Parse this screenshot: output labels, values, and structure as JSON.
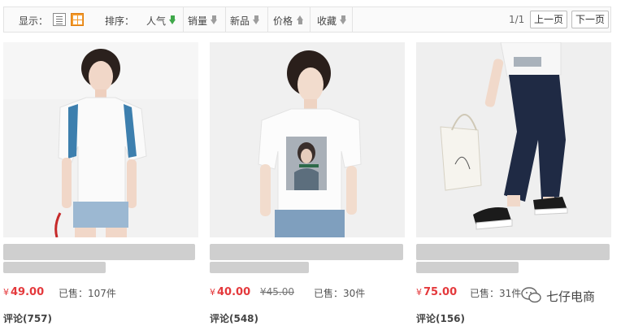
{
  "toolbar": {
    "display_label": "显示：",
    "sort_label": "排序：",
    "sort_items": [
      {
        "label": "人气",
        "arrow": "down",
        "active": true
      },
      {
        "label": "销量",
        "arrow": "down",
        "active": false
      },
      {
        "label": "新品",
        "arrow": "down",
        "active": false
      },
      {
        "label": "价格",
        "arrow": "up",
        "active": false
      },
      {
        "label": "收藏",
        "arrow": "down",
        "active": false
      }
    ],
    "page_count": "1/1",
    "prev_label": "上一页",
    "next_label": "下一页"
  },
  "colors": {
    "active_arrow": "#3fa84a",
    "inactive_arrow": "#9d9d9d",
    "grid_icon": "#f39a2c",
    "price": "#e4393c"
  },
  "products": [
    {
      "currency": "¥",
      "price": "49.00",
      "original_price": "",
      "sold": "已售：107件",
      "comments": "评论(757)"
    },
    {
      "currency": "¥",
      "price": "40.00",
      "original_price": "¥45.00",
      "sold": "已售：30件",
      "comments": "评论(548)"
    },
    {
      "currency": "¥",
      "price": "75.00",
      "original_price": "",
      "sold": "已售：31件",
      "comments": "评论(156)"
    }
  ],
  "watermark": {
    "text": "七仔电商",
    "icon": "wechat-icon"
  }
}
